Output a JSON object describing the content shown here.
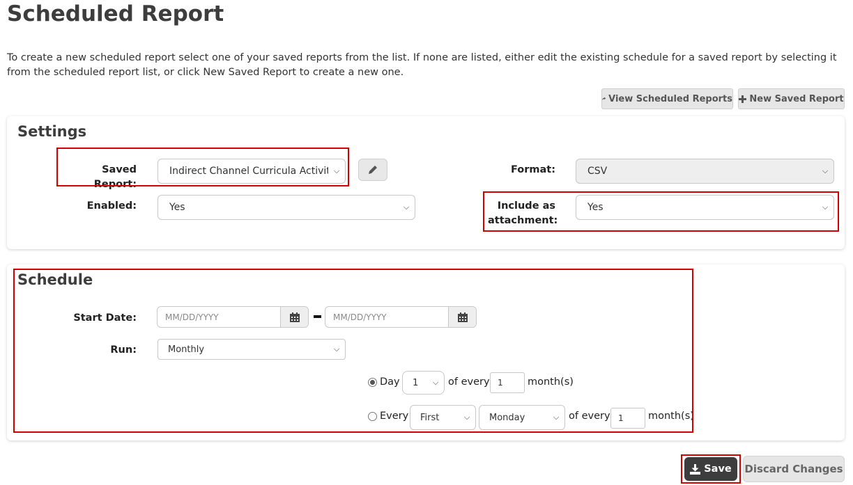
{
  "page": {
    "title": "Scheduled Report",
    "intro": "To create a new scheduled report select one of your saved reports from the list. If none are listed, either edit the existing schedule for a saved report by selecting it from the scheduled report list, or click New Saved Report to create a new one."
  },
  "toolbar": {
    "view_scheduled_label": "View Scheduled Reports",
    "view_scheduled_icon": "share-arrow-icon",
    "new_saved_label": "New Saved Report",
    "new_saved_icon": "plus-icon"
  },
  "settings": {
    "heading": "Settings",
    "saved_report_label": "Saved Report:",
    "saved_report_value": "Indirect Channel Curricula Activity",
    "edit_icon": "pencil-icon",
    "format_label": "Format:",
    "format_value": "CSV",
    "enabled_label": "Enabled:",
    "enabled_value": "Yes",
    "attachment_label": "Include as attachment:",
    "attachment_value": "Yes"
  },
  "schedule": {
    "heading": "Schedule",
    "start_date_label": "Start Date:",
    "start_placeholder": "MM/DD/YYYY",
    "end_placeholder": "MM/DD/YYYY",
    "calendar_icon": "calendar-icon",
    "run_label": "Run:",
    "run_value": "Monthly",
    "option_day": {
      "label": "Day",
      "day_value": "1",
      "of_every": "of every",
      "count": "1",
      "unit": "month(s)",
      "selected": true
    },
    "option_every": {
      "label": "Every",
      "ordinal_value": "First",
      "weekday_value": "Monday",
      "of_every": "of every",
      "count": "1",
      "unit": "month(s)",
      "selected": false
    }
  },
  "actions": {
    "save_label": "Save",
    "save_icon": "download-icon",
    "discard_label": "Discard Changes"
  },
  "colors": {
    "highlight": "#d40000",
    "save_bg": "#3d3d3d",
    "button_gray": "#e6e6e6"
  }
}
